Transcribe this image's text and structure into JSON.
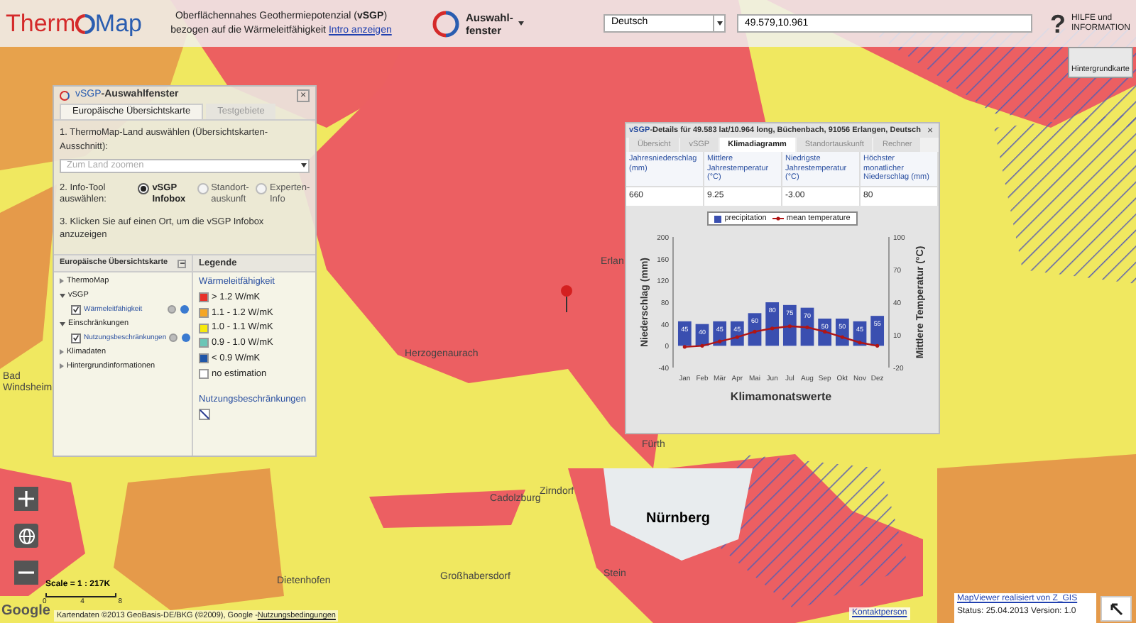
{
  "header": {
    "logo": {
      "part1": "Therm",
      "part2": "Map"
    },
    "description": {
      "line1": "Oberflächennahes Geothermiepotenzial (**vSGP**)",
      "line2": "bezogen auf die Wärmeleitfähigkeit",
      "link": "Intro anzeigen"
    },
    "selection_button": {
      "lines": [
        "Auswahl-",
        "fenster"
      ]
    },
    "language": {
      "value": "Deutsch"
    },
    "coordinates": {
      "value": "49.579,10.961"
    },
    "help": {
      "symbol": "?",
      "lines": [
        "HILFE und",
        "INFORMATION"
      ]
    }
  },
  "background_map_button": {
    "label": "Hintergrundkarte"
  },
  "map_labels": [
    {
      "text": "Erlan",
      "kind": "town"
    },
    {
      "text": "Fürth",
      "kind": "town"
    },
    {
      "text": "Nürnberg",
      "kind": "city"
    },
    {
      "text": "Zirndorf",
      "kind": "town"
    },
    {
      "text": "Cadolzburg",
      "kind": "town"
    },
    {
      "text": "Stein",
      "kind": "town"
    },
    {
      "text": "Großhabersdorf",
      "kind": "town"
    },
    {
      "text": "Dietenhofen",
      "kind": "town"
    },
    {
      "text": "Herzogenaurach",
      "kind": "town"
    },
    {
      "text": "Bad Windsheim",
      "kind": "stacked_town"
    }
  ],
  "selection_window": {
    "title_prefix": "vSGP",
    "title": "-Auswahlfenster",
    "close": "×",
    "tabs": [
      {
        "label": "Europäische Übersichtskarte",
        "selected": true
      },
      {
        "label": "Testgebiete",
        "selected": false
      }
    ],
    "step1": {
      "label": "1. ThermoMap-Land auswählen (Übersichtskarten-Ausschnitt):",
      "placeholder": "Zum Land zoomen"
    },
    "step2": {
      "label": "2. Info-Tool auswählen:",
      "options": [
        {
          "label": "vSGP Infobox",
          "selected": true
        },
        {
          "label": "Standort-auskunft",
          "selected": false
        },
        {
          "label": "Experten-Info",
          "selected": false
        }
      ]
    },
    "step3": "3. Klicken Sie auf einen Ort, um die vSGP Infobox anzuzeigen",
    "tree": {
      "title": "Europäische Übersichtskarte",
      "items": [
        {
          "label": "ThermoMap",
          "kind": "folder",
          "expanded": false
        },
        {
          "label": "vSGP",
          "kind": "folder",
          "expanded": true,
          "children": [
            {
              "label": "Wärmeleitfähigkeit",
              "kind": "layer",
              "checked": true
            }
          ]
        },
        {
          "label": "Einschränkungen",
          "kind": "folder",
          "expanded": true,
          "children": [
            {
              "label": "Nutzungsbeschränkungen",
              "kind": "layer",
              "checked": true
            }
          ]
        },
        {
          "label": "Klimadaten",
          "kind": "folder",
          "expanded": false
        },
        {
          "label": "Hintergrundinformationen",
          "kind": "folder",
          "expanded": false
        }
      ]
    },
    "legend": {
      "title": "Legende",
      "section": "Wärmeleitfähigkeit",
      "items": [
        {
          "label": "> 1.2 W/mK",
          "color": "#e8312a"
        },
        {
          "label": "1.1 - 1.2 W/mK",
          "color": "#f5a623"
        },
        {
          "label": "1.0 - 1.1 W/mK",
          "color": "#f7ea0c"
        },
        {
          "label": "0.9 - 1.0 W/mK",
          "color": "#6cc6b6"
        },
        {
          "label": "< 0.9 W/mK",
          "color": "#1f56a8"
        },
        {
          "label": "no estimation",
          "color": "#ffffff"
        }
      ],
      "restrictions": "Nutzungsbeschränkungen"
    }
  },
  "details_window": {
    "title_prefix": "vSGP",
    "title": "-Details für 49.583 lat/10.964 long, Büchenbach, 91056 Erlangen, Deutsch",
    "close": "×",
    "tabs": [
      {
        "label": "Übersicht",
        "selected": false
      },
      {
        "label": "vSGP",
        "selected": false
      },
      {
        "label": "Klimadiagramm",
        "selected": true
      },
      {
        "label": "Standortauskunft",
        "selected": false
      },
      {
        "label": "Rechner",
        "selected": false
      }
    ],
    "table": {
      "columns": [
        "Jahresniederschlag (mm)",
        "Mittlere Jahrestemperatur (°C)",
        "Niedrigste Jahrestemperatur (°C)",
        "Höchster monatlicher Niederschlag (mm)"
      ],
      "row": [
        "660",
        "9.25",
        "-3.00",
        "80"
      ]
    },
    "precipitation_chart": {
      "chart_data": {
        "type": "bar",
        "xlabel": "Klimamonatswerte",
        "ylabel": "Niederschlag (mm)",
        "categories": [
          "Jan",
          "Feb",
          "Mär",
          "Apr",
          "Mai",
          "Jun",
          "Jul",
          "Aug",
          "Sep",
          "Okt",
          "Nov",
          "Dez"
        ],
        "series": [
          {
            "name": "precipitation",
            "color": "#3a4fb0",
            "values": [
              45,
              40,
              45,
              45,
              60,
              80,
              75,
              70,
              50,
              50,
              45,
              55
            ]
          }
        ],
        "ylim": [
          -40,
          200
        ],
        "yticks": [
          -40,
          0,
          40,
          80,
          120,
          160,
          200
        ],
        "data_labels": true
      }
    },
    "temperature_chart": {
      "chart_data": {
        "type": "line",
        "ylabel": "Mittlere Temperatur (°C)",
        "series": [
          {
            "name": "mean temperature",
            "color": "#b01515",
            "values": [
              -1,
              0,
              4,
              8,
              13,
              16,
              18,
              17,
              13,
              8,
              3,
              0
            ]
          }
        ],
        "ylim": [
          -20,
          100
        ],
        "yticks": [
          -20,
          10,
          40,
          70,
          100
        ]
      }
    }
  },
  "map_controls": {
    "scale": "Scale = 1 : 217K",
    "scale_ticks": [
      "0",
      "4",
      "8"
    ]
  },
  "footer": {
    "google": "Google",
    "attribution": "Kartendaten ©2013 GeoBasis-DE/BKG (©2009), Google - ",
    "terms_link": "Nutzungsbedingungen",
    "contact_link": "Kontaktperson",
    "credit_link": "MapViewer realisiert von Z_GIS",
    "status": "Status: 25.04.2013 Version: 1.0"
  }
}
